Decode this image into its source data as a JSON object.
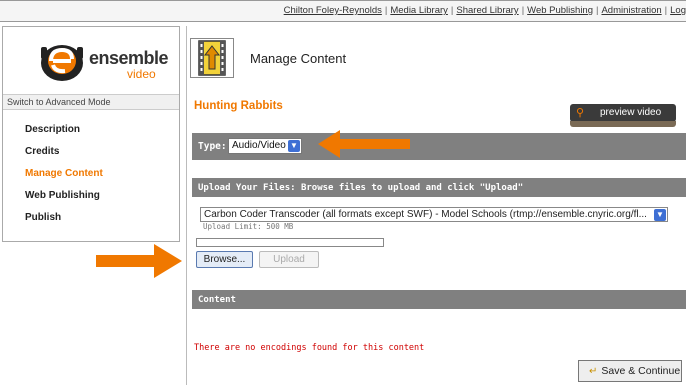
{
  "topnav": {
    "links": [
      "Chilton Foley-Reynolds",
      "Media Library",
      "Shared Library",
      "Web Publishing",
      "Administration",
      "Log"
    ]
  },
  "brand": {
    "wordmark": "ensemble",
    "sub": "video",
    "accent": "#f07800"
  },
  "sidebar": {
    "mode_label": "Switch to Advanced Mode",
    "items": [
      {
        "label": "Description"
      },
      {
        "label": "Credits"
      },
      {
        "label": "Manage Content"
      },
      {
        "label": "Web Publishing"
      },
      {
        "label": "Publish"
      }
    ],
    "active_index": 2
  },
  "header": {
    "title": "Manage Content",
    "icon": "film-upload-icon"
  },
  "page": {
    "title": "Hunting Rabbits",
    "preview_label": "preview video",
    "preview_icon": "search-icon"
  },
  "type_bar": {
    "label": "Type:",
    "selected": "Audio/Video"
  },
  "upload": {
    "bar_label": "Upload Your Files: Browse files to upload and click \"Upload\"",
    "transcoder": "Carbon Coder Transcoder (all formats except SWF) - Model Schools (rtmp://ensemble.cnyric.org/fl...",
    "limit": "Upload Limit: 500 MB",
    "browse_label": "Browse...",
    "upload_label": "Upload"
  },
  "content": {
    "bar_label": "Content",
    "empty_message": "There are no encodings found for this content"
  },
  "actions": {
    "save_label": "Save & Continue",
    "save_icon": "arrow-icon"
  },
  "colors": {
    "section_bar": "#808080",
    "annotation_arrow": "#f07800",
    "error_text": "#d00000"
  }
}
